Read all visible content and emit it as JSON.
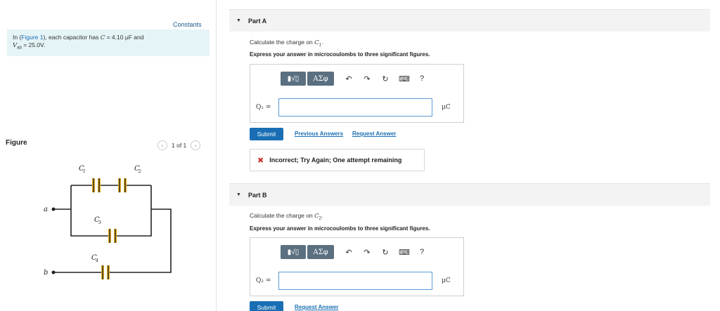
{
  "left": {
    "constants_link": "Constants",
    "intro": {
      "prefix": "In (",
      "figure_link": "Figure 1",
      "middle": "), each capacitor has ",
      "c_var": "C",
      "c_value": " = 4.10 μF and",
      "v_var": "V",
      "v_sub": "ab",
      "v_value": " = 25.0V."
    },
    "figure_title": "Figure",
    "pager": {
      "text": "1 of 1",
      "prev": "‹",
      "next": "›"
    },
    "circuit": {
      "labels": {
        "c1": "C",
        "c1_sub": "1",
        "c2": "C",
        "c2_sub": "2",
        "c3": "C",
        "c3_sub": "3",
        "c4": "C",
        "c4_sub": "4",
        "a": "a",
        "b": "b"
      },
      "colors": {
        "wire": "#222222",
        "cap_plate": "#e8b21e"
      }
    }
  },
  "parts": [
    {
      "title": "Part A",
      "question_prefix": "Calculate the charge on ",
      "question_var": "C",
      "question_sub": "1",
      "question_suffix": ".",
      "instruction": "Express your answer in microcoulombs to three significant figures.",
      "toolbar": {
        "templates": "▮√▯",
        "symbols": "ΑΣφ",
        "undo": "↶",
        "redo": "↷",
        "reset": "↻",
        "keyboard": "⌨",
        "help": "?"
      },
      "answer_label": "Q₁ =",
      "answer_value": "",
      "unit": "μC",
      "submit_label": "Submit",
      "link1": "Previous Answers",
      "link2": "Request Answer",
      "feedback_icon": "✖",
      "feedback": "Incorrect; Try Again; One attempt remaining"
    },
    {
      "title": "Part B",
      "question_prefix": "Calculate the charge on ",
      "question_var": "C",
      "question_sub": "2",
      "question_suffix": ".",
      "instruction": "Express your answer in microcoulombs to three significant figures.",
      "toolbar": {
        "templates": "▮√▯",
        "symbols": "ΑΣφ",
        "undo": "↶",
        "redo": "↷",
        "reset": "↻",
        "keyboard": "⌨",
        "help": "?"
      },
      "answer_label": "Q₂ =",
      "answer_value": "",
      "unit": "μC",
      "submit_label": "Submit",
      "link2": "Request Answer"
    }
  ],
  "colors": {
    "accent": "#1a6fb4",
    "intro_bg": "#e5f4f6",
    "toolbar_btn": "#5a6f80",
    "error": "#d0312d"
  }
}
